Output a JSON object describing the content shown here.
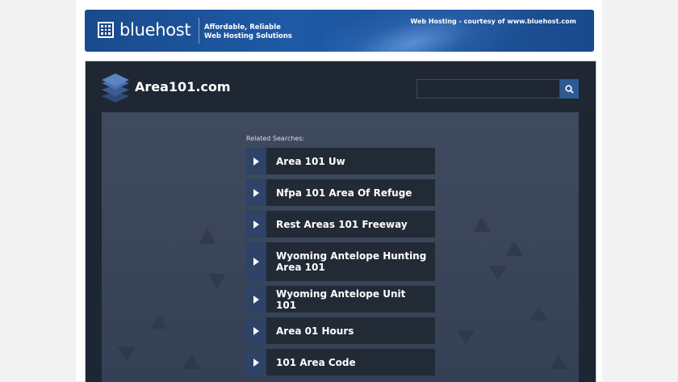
{
  "banner": {
    "brand": "bluehost",
    "tagline_line1": "Affordable, Reliable",
    "tagline_line2": "Web Hosting Solutions",
    "courtesy": "Web Hosting - courtesy of www.bluehost.com"
  },
  "header": {
    "site_name": "Area101.com",
    "search_value": ""
  },
  "related": {
    "title": "Related Searches:",
    "items": [
      {
        "label": "Area 101 Uw"
      },
      {
        "label": "Nfpa 101 Area Of Refuge"
      },
      {
        "label": "Rest Areas 101 Freeway"
      },
      {
        "label": "Wyoming Antelope Hunting Area 101"
      },
      {
        "label": "Wyoming Antelope Unit 101"
      },
      {
        "label": "Area 01 Hours"
      },
      {
        "label": "101 Area Code"
      }
    ]
  },
  "colors": {
    "banner": "#1f5aa6",
    "header_bg": "#1f2733",
    "content_bg": "#3a4559",
    "result_bg": "#222a36",
    "arrow_bg": "#2f4268",
    "search_button": "#2d5a93"
  },
  "icons": {
    "banner_logo": "grid-logo-icon",
    "site_logo": "stacked-layers-icon",
    "search": "search-icon",
    "result_arrow": "play-arrow-icon"
  }
}
